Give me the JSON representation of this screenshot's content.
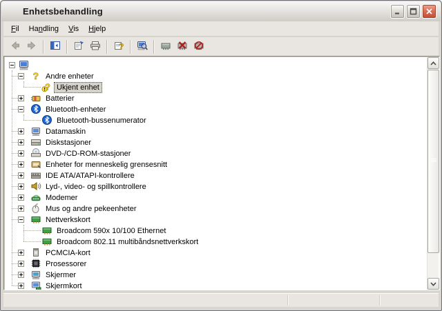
{
  "window": {
    "title": "Enhetsbehandling",
    "title_icon": "device-manager-icon",
    "controls": [
      {
        "name": "minimize-button",
        "icon": "minimize-icon"
      },
      {
        "name": "maximize-button",
        "icon": "maximize-icon"
      },
      {
        "name": "close-button",
        "icon": "close-icon"
      }
    ]
  },
  "menu_bar": {
    "items": [
      {
        "label": "Fil",
        "accel_index": 0
      },
      {
        "label": "Handling",
        "accel_index": 2
      },
      {
        "label": "Vis",
        "accel_index": 0
      },
      {
        "label": "Hjelp",
        "accel_index": 0
      }
    ]
  },
  "toolbar": {
    "buttons": [
      {
        "name": "back-button",
        "icon": "back-arrow-icon",
        "disabled": true,
        "sep_after": false
      },
      {
        "name": "forward-button",
        "icon": "forward-arrow-icon",
        "disabled": true,
        "sep_after": true
      },
      {
        "name": "show-hide-console-tree-button",
        "icon": "console-tree-icon",
        "disabled": false,
        "sep_after": true
      },
      {
        "name": "properties-button",
        "icon": "properties-icon",
        "disabled": false,
        "sep_after": false
      },
      {
        "name": "print-button",
        "icon": "print-icon",
        "disabled": false,
        "sep_after": true
      },
      {
        "name": "help-button",
        "icon": "help-icon",
        "disabled": false,
        "sep_after": true
      },
      {
        "name": "scan-hardware-changes-button",
        "icon": "scan-hardware-icon",
        "disabled": false,
        "sep_after": true
      },
      {
        "name": "update-driver-button",
        "icon": "update-driver-icon",
        "disabled": false,
        "sep_after": false
      },
      {
        "name": "uninstall-device-button",
        "icon": "uninstall-device-icon",
        "disabled": false,
        "sep_after": false
      },
      {
        "name": "disable-device-button",
        "icon": "disable-device-icon",
        "disabled": false,
        "sep_after": false
      }
    ]
  },
  "tree": {
    "rows": [
      {
        "level": 0,
        "expander": "minus",
        "icon": "computer-icon",
        "label": "",
        "selected": false
      },
      {
        "level": 1,
        "expander": "minus",
        "icon": "unknown-device-icon",
        "label": "Andre enheter",
        "selected": false
      },
      {
        "level": 2,
        "expander": null,
        "icon": "unknown-device-warning-icon",
        "label": "Ukjent enhet",
        "selected": true
      },
      {
        "level": 1,
        "expander": "plus",
        "icon": "battery-icon",
        "label": "Batterier",
        "selected": false
      },
      {
        "level": 1,
        "expander": "minus",
        "icon": "bluetooth-icon",
        "label": "Bluetooth-enheter",
        "selected": false
      },
      {
        "level": 2,
        "expander": null,
        "icon": "bluetooth-icon",
        "label": "Bluetooth-bussenumerator",
        "selected": false
      },
      {
        "level": 1,
        "expander": "plus",
        "icon": "computer-small-icon",
        "label": "Datamaskin",
        "selected": false
      },
      {
        "level": 1,
        "expander": "plus",
        "icon": "disk-drive-icon",
        "label": "Diskstasjoner",
        "selected": false
      },
      {
        "level": 1,
        "expander": "plus",
        "icon": "cdrom-drive-icon",
        "label": "DVD-/CD-ROM-stasjoner",
        "selected": false
      },
      {
        "level": 1,
        "expander": "plus",
        "icon": "hid-icon",
        "label": "Enheter for menneskelig grensesnitt",
        "selected": false
      },
      {
        "level": 1,
        "expander": "plus",
        "icon": "ide-controller-icon",
        "label": "IDE ATA/ATAPI-kontrollere",
        "selected": false
      },
      {
        "level": 1,
        "expander": "plus",
        "icon": "sound-icon",
        "label": "Lyd-, video- og spillkontrollere",
        "selected": false
      },
      {
        "level": 1,
        "expander": "plus",
        "icon": "modem-icon",
        "label": "Modemer",
        "selected": false
      },
      {
        "level": 1,
        "expander": "plus",
        "icon": "mouse-icon",
        "label": "Mus og andre pekeenheter",
        "selected": false
      },
      {
        "level": 1,
        "expander": "minus",
        "icon": "network-adapter-icon",
        "label": "Nettverkskort",
        "selected": false
      },
      {
        "level": 2,
        "expander": null,
        "icon": "network-adapter-icon",
        "label": "Broadcom 590x 10/100 Ethernet",
        "selected": false
      },
      {
        "level": 2,
        "expander": null,
        "icon": "network-adapter-icon",
        "label": "Broadcom 802.11 multibåndsnettverkskort",
        "selected": false
      },
      {
        "level": 1,
        "expander": "plus",
        "icon": "pcmcia-card-icon",
        "label": "PCMCIA-kort",
        "selected": false
      },
      {
        "level": 1,
        "expander": "plus",
        "icon": "processor-icon",
        "label": "Prosessorer",
        "selected": false
      },
      {
        "level": 1,
        "expander": "plus",
        "icon": "monitor-icon",
        "label": "Skjermer",
        "selected": false
      },
      {
        "level": 1,
        "expander": "plus",
        "icon": "display-adapter-icon",
        "label": "Skjermkort",
        "selected": false
      }
    ]
  },
  "status_bar": {
    "panels": [
      "",
      "",
      ""
    ]
  },
  "colors": {
    "selection_background": "#D5D2CB",
    "close_button_red": "#C14C33",
    "titlebar_top": "#F8F7F5",
    "titlebar_bottom": "#CFCCC6",
    "chrome_face": "#E9E6E1"
  }
}
